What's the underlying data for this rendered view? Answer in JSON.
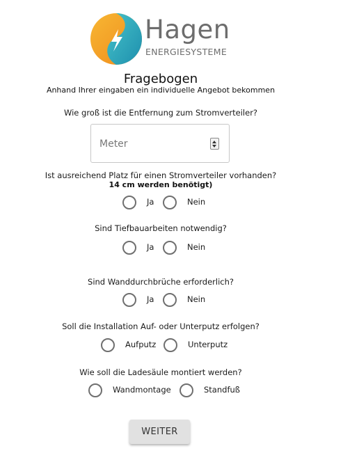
{
  "logo": {
    "word": "Hagen",
    "sub": "ENERGIESYSTEME",
    "icon": "lightning-leaf-icon",
    "colors": {
      "orange": "#f5a623",
      "teal": "#2aa6b8",
      "text": "#6d6d6d"
    }
  },
  "title": "Fragebogen",
  "subtitle": "Anhand Ihrer eingaben ein individuelle Angebot bekommen",
  "q1": {
    "question": "Wie groß ist die Entfernung zum Stromverteiler?",
    "placeholder": "Meter",
    "value": ""
  },
  "q2": {
    "question": "Ist ausreichend Platz für einen Stromverteiler vorhanden?",
    "note": "14 cm werden benötigt)",
    "options": [
      "Ja",
      "Nein"
    ]
  },
  "q3": {
    "question": "Sind Tiefbauarbeiten notwendig?",
    "options": [
      "Ja",
      "Nein"
    ]
  },
  "q4": {
    "question": "Sind Wanddurchbrüche erforderlich?",
    "options": [
      "Ja",
      "Nein"
    ]
  },
  "q5": {
    "question": "Soll die Installation Auf- oder Unterputz erfolgen?",
    "options": [
      "Aufputz",
      "Unterputz"
    ]
  },
  "q6": {
    "question": "Wie soll die Ladesäule montiert werden?",
    "options": [
      "Wandmontage",
      "Standfuß"
    ]
  },
  "button": {
    "label": "WEITER"
  }
}
